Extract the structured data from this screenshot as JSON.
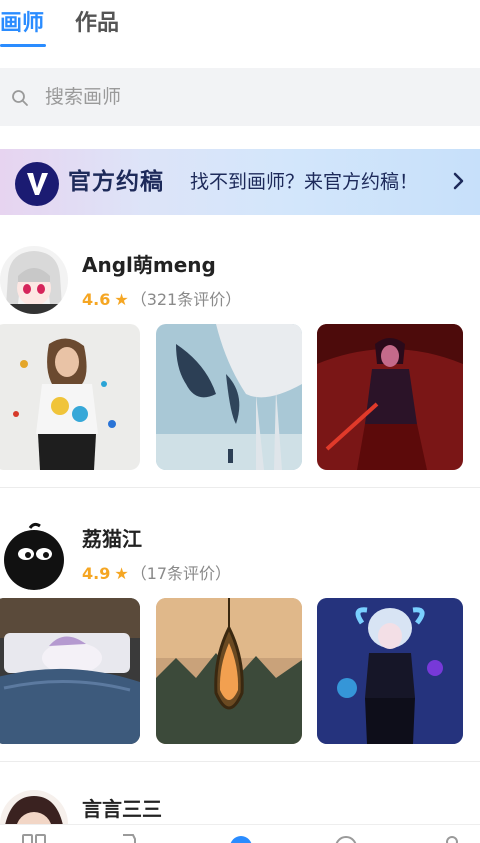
{
  "tabs": [
    {
      "label": "画师",
      "active": true
    },
    {
      "label": "作品",
      "active": false
    }
  ],
  "search": {
    "placeholder": "搜索画师",
    "icon": "search-icon"
  },
  "banner": {
    "logo_letter": "V",
    "brand": "官方约稿",
    "text": "找不到画师？来官方约稿！",
    "icon": "chevron-right-icon"
  },
  "artists": [
    {
      "name": "Angl萌meng",
      "rating": "4.6",
      "reviews": "（321条评价）",
      "star": "★",
      "artworks": [
        "paint-splash-girl",
        "mecha-creature-sky",
        "red-dark-warrior"
      ]
    },
    {
      "name": "荔猫江",
      "rating": "4.9",
      "reviews": "（17条评价）",
      "star": "★",
      "artworks": [
        "sleeping-unicorn-bed",
        "sunset-pendant",
        "horned-neon-girl"
      ]
    },
    {
      "name": "言言三三",
      "rating": "",
      "reviews": "",
      "star": "",
      "artworks": []
    }
  ],
  "colors": {
    "accent": "#2a8cff",
    "star": "#f5a623",
    "banner_text": "#1d2a5a"
  },
  "bottom_nav": [
    "home-icon",
    "list-icon",
    "create-icon",
    "message-icon",
    "profile-icon"
  ]
}
